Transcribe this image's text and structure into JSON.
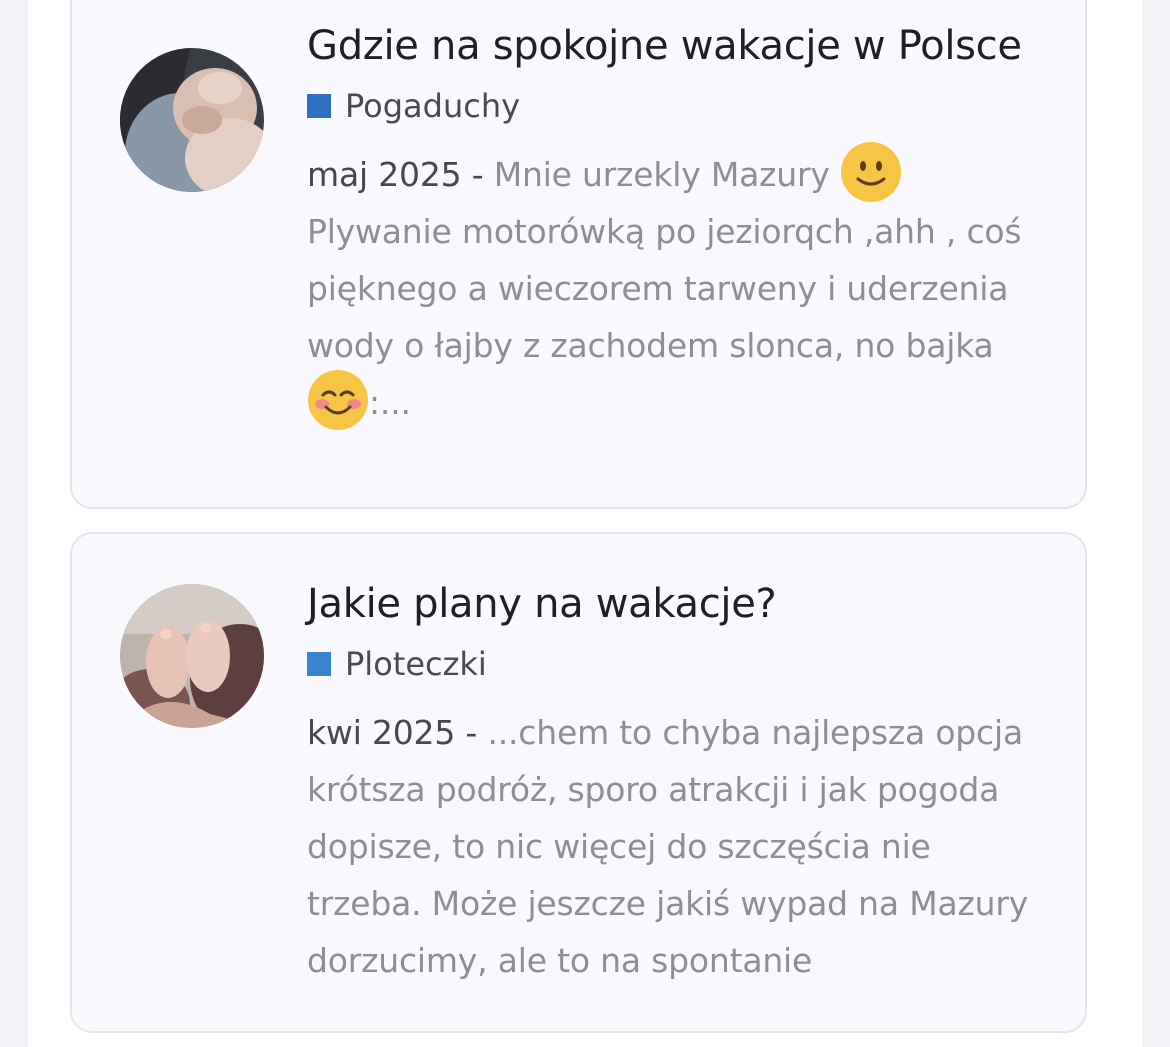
{
  "posts": [
    {
      "title": "Gdzie na spokojne wakacje w Polsce",
      "category": "Pogaduchy",
      "category_color": "#2e6fc1",
      "date": "maj 2025 - ",
      "snippet_1": "Mnie urzekly Mazury ",
      "snippet_2": "Plywanie motorówką po jeziorqch ,ahh , coś pięknego a wieczorem tarweny i uderzenia wody o łajby z zachodem slonca, no bajka ",
      "snippet_3": ":...",
      "emoji_1": "slightly-smiling-face-icon",
      "emoji_2": "smiling-face-with-blush-icon"
    },
    {
      "title": "Jakie plany na wakacje?",
      "category": "Ploteczki",
      "category_color": "#3a83cf",
      "date": "kwi 2025 - ",
      "snippet": "...chem to chyba najlepsza opcja krótsza podróż, sporo atrakcji i jak pogoda dopisze, to nic więcej do szczęścia nie trzeba. Może jeszcze jakiś wypad na Mazury dorzucimy, ale to na spontanie"
    }
  ]
}
